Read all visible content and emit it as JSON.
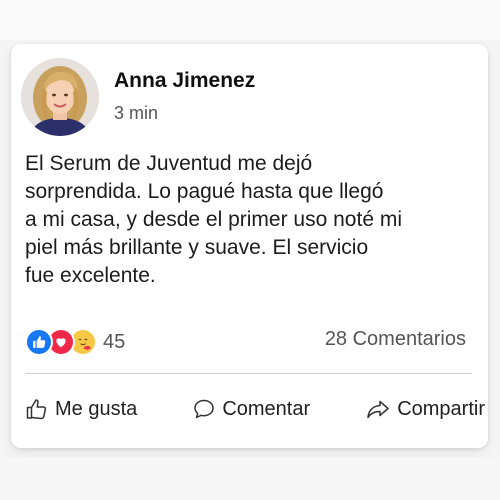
{
  "post": {
    "author": "Anna Jimenez",
    "time": "3 min",
    "text_lines": [
      "El Serum de Juventud me dejó",
      "sorprendida. Lo pagué hasta que llegó",
      "a mi casa, y desde el primer uso noté mi",
      "piel más brillante y suave. El servicio",
      "fue excelente."
    ]
  },
  "reactions": {
    "icons": [
      "like-icon",
      "love-icon",
      "care-icon"
    ],
    "count": "45"
  },
  "comments": {
    "label": "28 Comentarios"
  },
  "actions": {
    "like_label": "Me gusta",
    "comment_label": "Comentar",
    "share_label": "Compartir"
  },
  "colors": {
    "like": "#1877f2",
    "love": "#f0284a",
    "care": "#f7c845",
    "text": "#1c1c1c",
    "muted": "#555555"
  }
}
